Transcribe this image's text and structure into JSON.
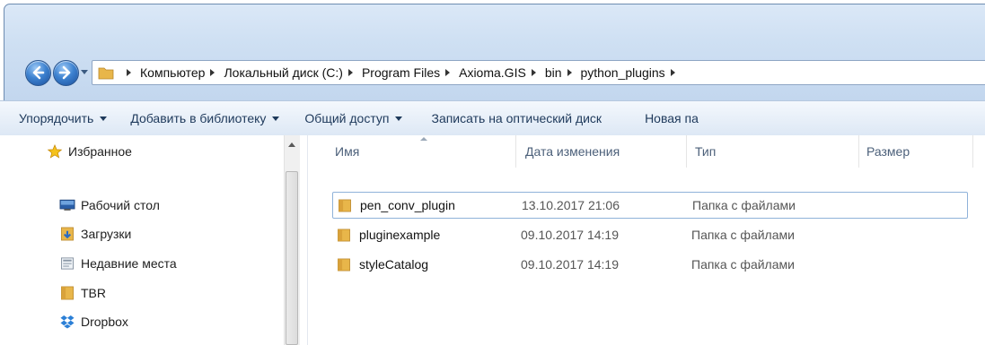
{
  "breadcrumbs": [
    "Компьютер",
    "Локальный диск (C:)",
    "Program Files",
    "Axioma.GIS",
    "bin",
    "python_plugins"
  ],
  "toolbar": {
    "organize": "Упорядочить",
    "add_to_library": "Добавить в библиотеку",
    "share": "Общий доступ",
    "burn": "Записать на оптический диск",
    "new_folder": "Новая па"
  },
  "sidebar": {
    "favorites": "Избранное",
    "items": [
      {
        "label": "Рабочий стол",
        "icon": "desktop-icon"
      },
      {
        "label": "Загрузки",
        "icon": "downloads-icon"
      },
      {
        "label": "Недавние места",
        "icon": "recent-places-icon"
      },
      {
        "label": "TBR",
        "icon": "folder-icon"
      },
      {
        "label": "Dropbox",
        "icon": "dropbox-icon"
      }
    ]
  },
  "columns": {
    "name": "Имя",
    "date": "Дата изменения",
    "type": "Тип",
    "size": "Размер"
  },
  "files": [
    {
      "name": "pen_conv_plugin",
      "date": "13.10.2017 21:06",
      "type": "Папка с файлами",
      "selected": true
    },
    {
      "name": "pluginexample",
      "date": "09.10.2017 14:19",
      "type": "Папка с файлами",
      "selected": false
    },
    {
      "name": "styleCatalog",
      "date": "09.10.2017 14:19",
      "type": "Папка с файлами",
      "selected": false
    }
  ],
  "colors": {
    "frame": "#cfe0f3",
    "folder": "#e8b64a",
    "selection_border": "#8fb2d9"
  }
}
